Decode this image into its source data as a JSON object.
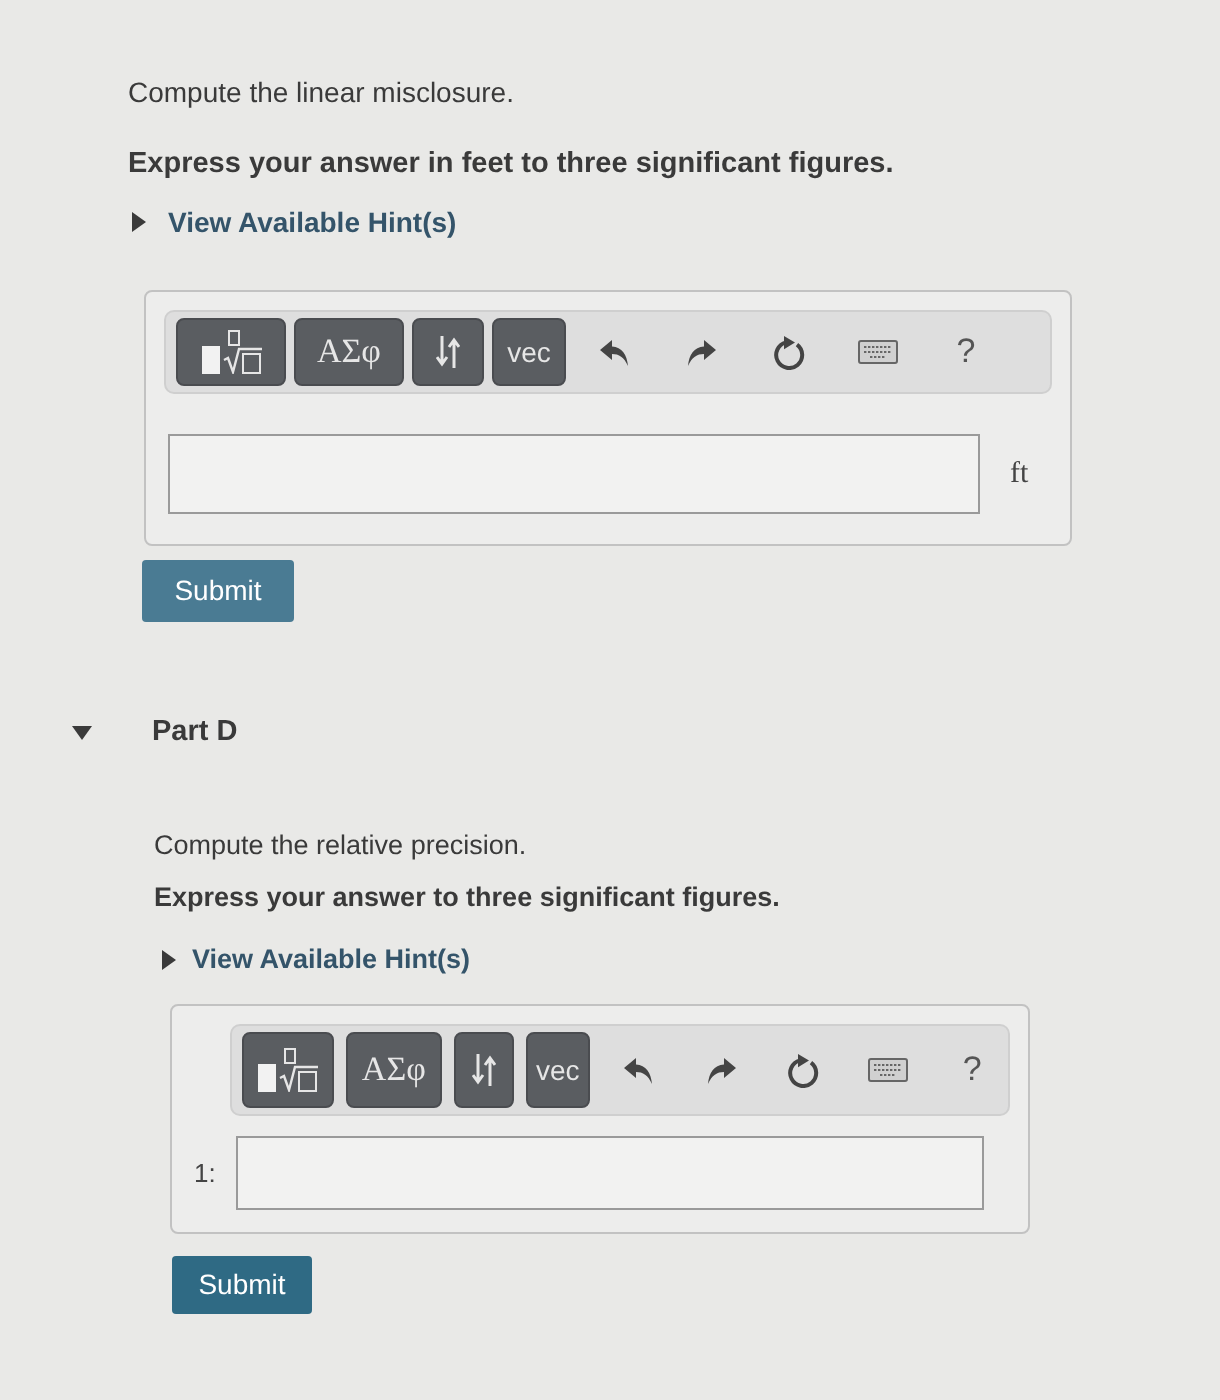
{
  "parts": [
    {
      "prompt": "Compute the linear misclosure.",
      "instruction": "Express your answer in feet to three significant figures.",
      "hint": {
        "label": "View Available Hint(s)",
        "expanded": false
      },
      "toolbar": [
        {
          "kind": "templates"
        },
        {
          "kind": "symbols",
          "label": "ΑΣφ"
        },
        {
          "kind": "arrows"
        },
        {
          "kind": "vec",
          "label": "vec"
        },
        {
          "kind": "undo"
        },
        {
          "kind": "redo"
        },
        {
          "kind": "reset"
        },
        {
          "kind": "keyboard"
        },
        {
          "kind": "help",
          "label": "?"
        }
      ],
      "answer": {
        "unit": "ft"
      },
      "submit": "Submit"
    },
    {
      "title": "Part D",
      "expanded": true,
      "prompt": "Compute the relative precision.",
      "instruction": "Express your answer to three significant figures.",
      "hint": {
        "label": "View Available Hint(s)",
        "expanded": false
      },
      "toolbar": [
        {
          "kind": "templates"
        },
        {
          "kind": "symbols",
          "label": "ΑΣφ"
        },
        {
          "kind": "arrows"
        },
        {
          "kind": "vec",
          "label": "vec"
        },
        {
          "kind": "undo"
        },
        {
          "kind": "redo"
        },
        {
          "kind": "reset"
        },
        {
          "kind": "keyboard"
        },
        {
          "kind": "help",
          "label": "?"
        }
      ],
      "answer": {
        "label": "1:"
      },
      "submit": "Submit"
    }
  ]
}
